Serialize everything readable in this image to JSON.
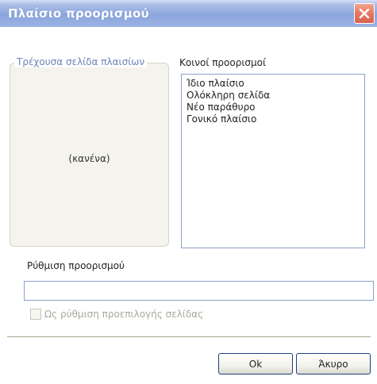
{
  "window": {
    "title": "Πλαίσιο προορισμού"
  },
  "current_frames": {
    "group_label": "Τρέχουσα σελίδα πλαισίων",
    "empty_text": "(κανένα)"
  },
  "common_targets": {
    "label": "Κοινοί προορισμοί",
    "items": [
      "Ίδιο πλαίσιο",
      "Ολόκληρη σελίδα",
      "Νέο παράθυρο",
      "Γονικό πλαίσιο"
    ]
  },
  "target_setting": {
    "label": "Ρύθμιση προορισμού",
    "value": "",
    "placeholder": ""
  },
  "default_checkbox": {
    "label": "Ως ρύθμιση προεπιλογής σελίδας",
    "checked": false,
    "enabled": false
  },
  "buttons": {
    "ok": "Ok",
    "cancel": "Άκυρο"
  },
  "colors": {
    "title_bar": "#9cb3e3",
    "close_button": "#e57862",
    "group_label_text": "#6b84b8",
    "disabled_text": "#a9a79f"
  },
  "icons": {
    "close": "close-icon"
  }
}
